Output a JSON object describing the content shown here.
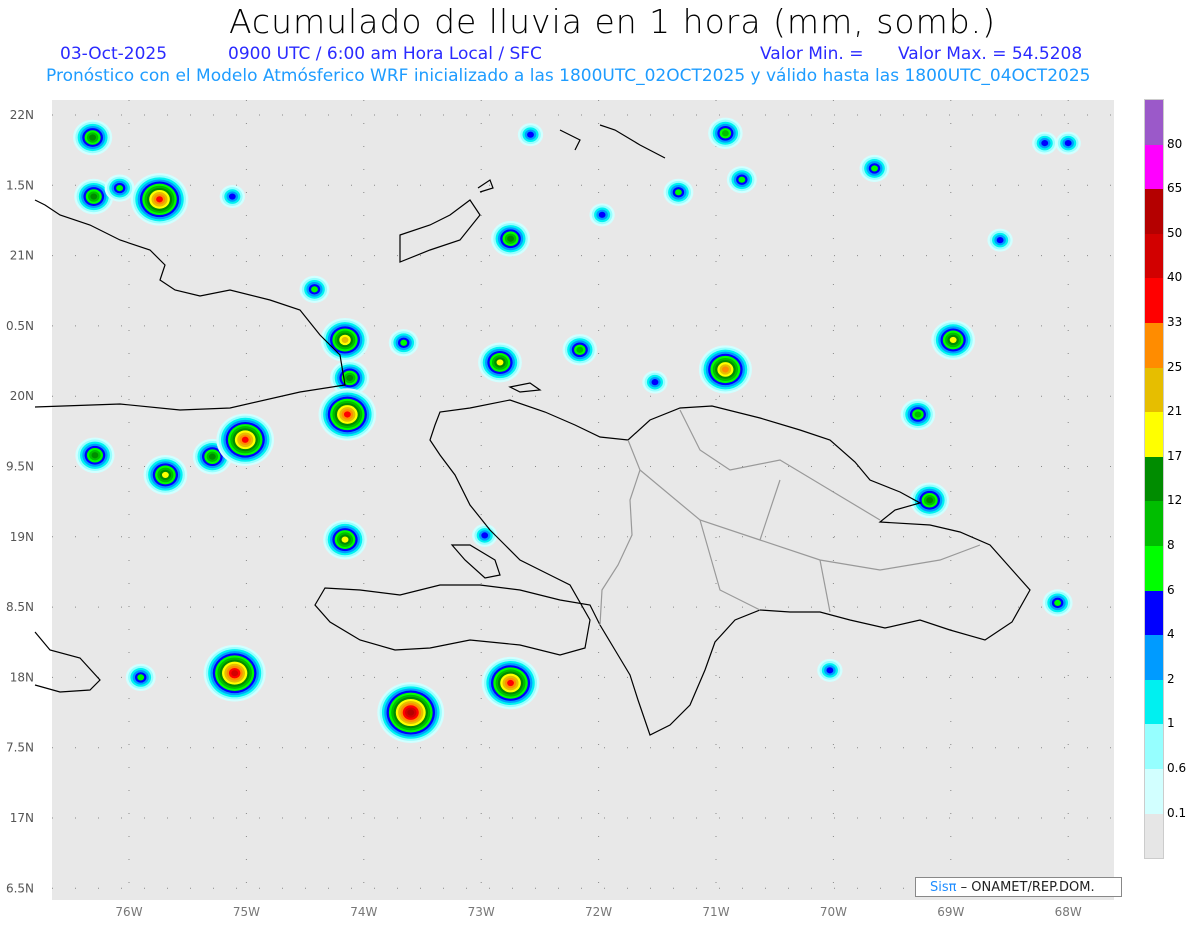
{
  "header": {
    "title": "Acumulado de lluvia en 1 hora (mm, somb.)",
    "date": "03-Oct-2025",
    "time": "0900 UTC / 6:00 am Hora Local / SFC",
    "min_label": "Valor Min. =",
    "max_label": "Valor Max. = 54.5208",
    "subtitle": "Pronóstico con el Modelo Atmósferico WRF inicializado a las 1800UTC_02OCT2025 y válido hasta las  1800UTC_04OCT2025"
  },
  "axes": {
    "lat_labels": [
      "22N",
      "1.5N",
      "21N",
      "0.5N",
      "20N",
      "9.5N",
      "19N",
      "8.5N",
      "18N",
      "7.5N",
      "17N",
      "6.5N"
    ],
    "lat_values": [
      22,
      21.5,
      21,
      20.5,
      20,
      19.5,
      19,
      18.5,
      18,
      17.5,
      17,
      16.5
    ],
    "lon_labels": [
      "76W",
      "75W",
      "74W",
      "73W",
      "72W",
      "71W",
      "70W",
      "69W",
      "68W"
    ],
    "lon_values": [
      76,
      75,
      74,
      73,
      72,
      71,
      70,
      69,
      68
    ]
  },
  "colorbar": {
    "colors": [
      "#9b59c9",
      "#ff00ff",
      "#b40000",
      "#d20000",
      "#ff0000",
      "#ff8c00",
      "#e6be00",
      "#ffff00",
      "#008c00",
      "#00be00",
      "#00ff00",
      "#0000ff",
      "#009bff",
      "#00f0f0",
      "#96ffff",
      "#d2ffff",
      "#e6e6e6"
    ],
    "labels": [
      "80",
      "65",
      "50",
      "40",
      "33",
      "25",
      "21",
      "17",
      "12",
      "8",
      "6",
      "4",
      "2",
      "1",
      "0.6",
      "0.1"
    ],
    "thresholds": [
      0.1,
      0.6,
      1,
      2,
      4,
      6,
      8,
      12,
      17,
      21,
      25,
      33,
      40,
      50,
      65,
      80
    ]
  },
  "rain_cells_lonW_lat_max": [
    [
      76.31,
      21.84,
      12
    ],
    [
      76.3,
      21.42,
      12
    ],
    [
      75.74,
      21.4,
      33
    ],
    [
      76.08,
      21.48,
      6
    ],
    [
      75.12,
      21.42,
      4
    ],
    [
      74.42,
      20.76,
      6
    ],
    [
      74.16,
      20.4,
      21
    ],
    [
      74.12,
      20.13,
      12
    ],
    [
      74.14,
      19.87,
      33
    ],
    [
      73.66,
      20.38,
      6
    ],
    [
      72.58,
      21.86,
      4
    ],
    [
      72.75,
      21.12,
      12
    ],
    [
      72.84,
      20.24,
      17
    ],
    [
      72.16,
      20.33,
      8
    ],
    [
      70.92,
      20.19,
      25
    ],
    [
      70.92,
      21.87,
      8
    ],
    [
      70.78,
      21.54,
      6
    ],
    [
      69.65,
      21.62,
      6
    ],
    [
      68.98,
      20.4,
      17
    ],
    [
      69.28,
      19.87,
      8
    ],
    [
      69.18,
      19.26,
      12
    ],
    [
      75.29,
      19.57,
      12
    ],
    [
      75.69,
      19.44,
      17
    ],
    [
      75.01,
      19.69,
      33
    ],
    [
      74.16,
      18.98,
      17
    ],
    [
      75.1,
      18.03,
      40
    ],
    [
      73.6,
      17.75,
      50
    ],
    [
      72.75,
      17.96,
      33
    ],
    [
      75.9,
      18.0,
      6
    ],
    [
      70.03,
      18.05,
      4
    ],
    [
      68.09,
      18.53,
      6
    ],
    [
      71.52,
      20.1,
      4
    ],
    [
      68.0,
      21.8,
      4
    ],
    [
      68.2,
      21.8,
      4
    ],
    [
      68.58,
      21.11,
      4
    ],
    [
      71.97,
      21.29,
      4
    ],
    [
      71.32,
      21.45,
      6
    ],
    [
      72.97,
      19.01,
      4
    ],
    [
      76.29,
      19.58,
      12
    ]
  ],
  "credit": {
    "brand": "Sisπ",
    "text": " –  ONAMET/REP.DOM."
  }
}
